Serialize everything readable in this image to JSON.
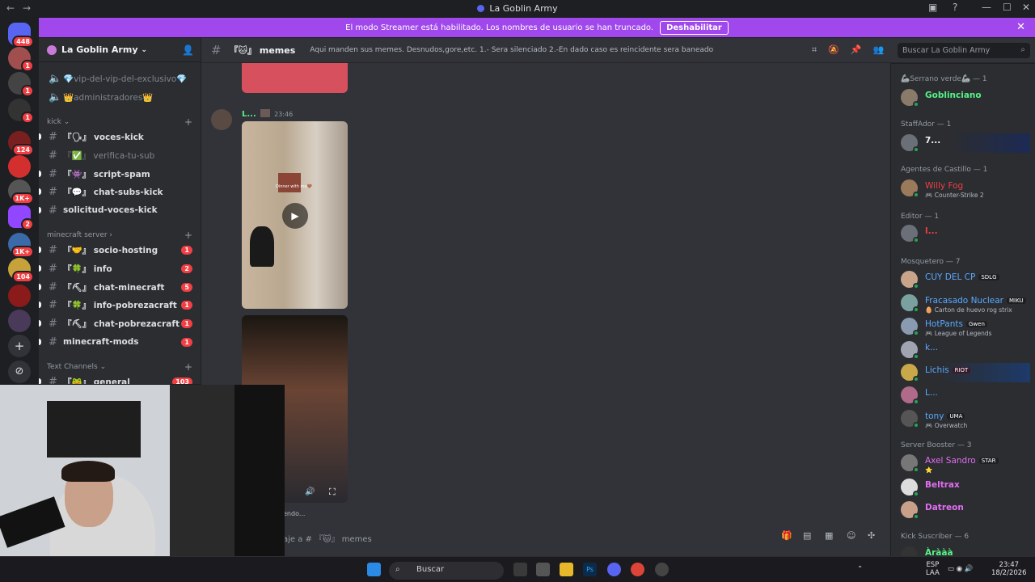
{
  "window": {
    "title": "La Goblin Army"
  },
  "banner": {
    "text": "El modo Streamer está habilitado. Los nombres de usuario se han truncado.",
    "button": "Deshabilitar"
  },
  "guild_badges": [
    "448",
    "1",
    "1",
    "1",
    "124",
    "1K+",
    "2",
    "1K+",
    "104"
  ],
  "server": {
    "name": "La Goblin Army"
  },
  "channels": {
    "top": [
      {
        "label": "💎vip-del-vip-del-exclusivo💎"
      },
      {
        "label": "👑administradores👑"
      }
    ],
    "kick_category": "kick",
    "kick": [
      {
        "label": "『🗣』 voces-kick"
      },
      {
        "label": "『✅』 verifica-tu-sub"
      },
      {
        "label": "『👾』 script-spam"
      },
      {
        "label": "『💬』 chat-subs-kick"
      },
      {
        "label": "solicitud-voces-kick"
      }
    ],
    "minecraft_category": "minecraft server",
    "minecraft": [
      {
        "label": "『🤝』 socio-hosting",
        "badge": "1"
      },
      {
        "label": "『🍀』 info",
        "badge": "2"
      },
      {
        "label": "『⛏』 chat-minecraft",
        "badge": "5"
      },
      {
        "label": "『🍀』 info-pobrezacraft",
        "badge": "1"
      },
      {
        "label": "『⛏』 chat-pobrezacraft",
        "badge": "1"
      },
      {
        "label": "minecraft-mods",
        "badge": "1"
      }
    ],
    "text_category": "Text Channels",
    "text": [
      {
        "label": "『🐸』 general",
        "badge": "103"
      }
    ]
  },
  "chat": {
    "channel_name": "『🐱』 memes",
    "topic": "Aqui manden sus memes. Desnudos,gore,etc. 1.- Sera silenciado 2.-En dado caso es reincidente sera baneado",
    "search_placeholder": "Buscar La Goblin Army",
    "message": {
      "author": "L...",
      "time": "23:46"
    },
    "video_caption": "Dinner with me🤎",
    "typing": "endo...",
    "composer_placeholder": "aje a # 『🐱』 memes"
  },
  "members": {
    "groups": [
      {
        "title": "🦾Serrano verde🦾 — 1",
        "members": [
          {
            "name": "Goblinciano",
            "color": "#57f287"
          }
        ]
      },
      {
        "title": "StaffAdor — 1",
        "members": [
          {
            "name": "7...",
            "color": "#f2f3f5"
          }
        ]
      },
      {
        "title": "Agentes de Castillo — 1",
        "members": [
          {
            "name": "Willy Fog",
            "color": "#f23f43",
            "activity": "🎮 Counter-Strike 2"
          }
        ]
      },
      {
        "title": "Editor — 1",
        "members": [
          {
            "name": "l...",
            "color": "#f23f43"
          }
        ]
      },
      {
        "title": "Mosquetero — 7",
        "members": [
          {
            "name": "CUY DEL CP",
            "color": "#5aa9ff",
            "tag": "SDLG"
          },
          {
            "name": "Fracasado Nuclear",
            "color": "#5aa9ff",
            "tag": "MIKU",
            "activity": "🥚 Carton de huevo rog strix"
          },
          {
            "name": "HotPants",
            "color": "#5aa9ff",
            "tag": "Gwen",
            "activity": "🎮 League of Legends"
          },
          {
            "name": "k...",
            "color": "#5aa9ff"
          },
          {
            "name": "Lichis",
            "color": "#5aa9ff",
            "tag": "RIOT"
          },
          {
            "name": "L...",
            "color": "#5aa9ff"
          },
          {
            "name": "tony",
            "color": "#5aa9ff",
            "tag": "UMA",
            "activity": "🎮 Overwatch"
          }
        ]
      },
      {
        "title": "Server Booster — 3",
        "members": [
          {
            "name": "Axel Sandro",
            "color": "#e36df2",
            "tag": "STAR",
            "activity": "⭐"
          },
          {
            "name": "Beltrax",
            "color": "#e36df2"
          },
          {
            "name": "Datreon",
            "color": "#e36df2"
          }
        ]
      },
      {
        "title": "Kick Suscriber — 6",
        "members": [
          {
            "name": "Àrààà",
            "color": "#57f287"
          }
        ]
      }
    ]
  },
  "taskbar": {
    "search": "Buscar",
    "lang": "ESP",
    "lang2": "LAA",
    "time": "23:47",
    "date": "18/2/2026"
  }
}
